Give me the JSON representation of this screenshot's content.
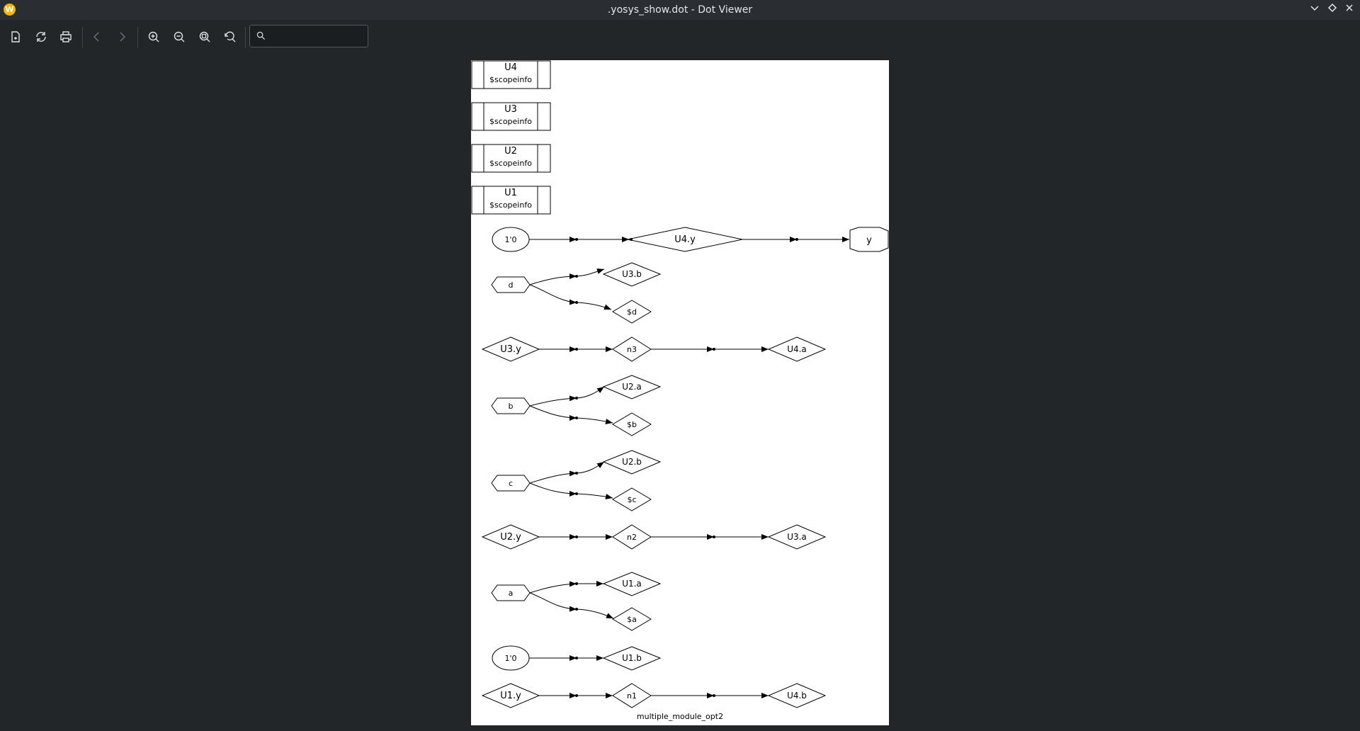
{
  "window": {
    "title": ".yosys_show.dot - Dot Viewer"
  },
  "toolbar": {
    "buttons": [
      "open-file",
      "reload",
      "print",
      "back",
      "forward",
      "zoom-in",
      "zoom-out",
      "zoom-fit",
      "zoom-reset"
    ],
    "search_value": ""
  },
  "graph": {
    "name": "multiple_module_opt2",
    "cells": [
      {
        "name": "U4",
        "type": "$scopeinfo"
      },
      {
        "name": "U3",
        "type": "$scopeinfo"
      },
      {
        "name": "U2",
        "type": "$scopeinfo"
      },
      {
        "name": "U1",
        "type": "$scopeinfo"
      }
    ],
    "nodes": {
      "const_top": "1'0",
      "u4y": "U4.y",
      "y": "y",
      "d": "d",
      "u3b": "U3.b",
      "sd": "$d",
      "u3y": "U3.y",
      "n3": "n3",
      "u4a": "U4.a",
      "b": "b",
      "u2a": "U2.a",
      "sb": "$b",
      "c": "c",
      "u2b": "U2.b",
      "sc": "$c",
      "u2y": "U2.y",
      "n2": "n2",
      "u3a": "U3.a",
      "a": "a",
      "u1a": "U1.a",
      "sa": "$a",
      "const_bot": "1'0",
      "u1b": "U1.b",
      "u1y": "U1.y",
      "n1": "n1",
      "u4b": "U4.b"
    },
    "colors": {
      "stroke": "#000000",
      "background": "#ffffff",
      "viewer_bg": "#232629"
    }
  }
}
